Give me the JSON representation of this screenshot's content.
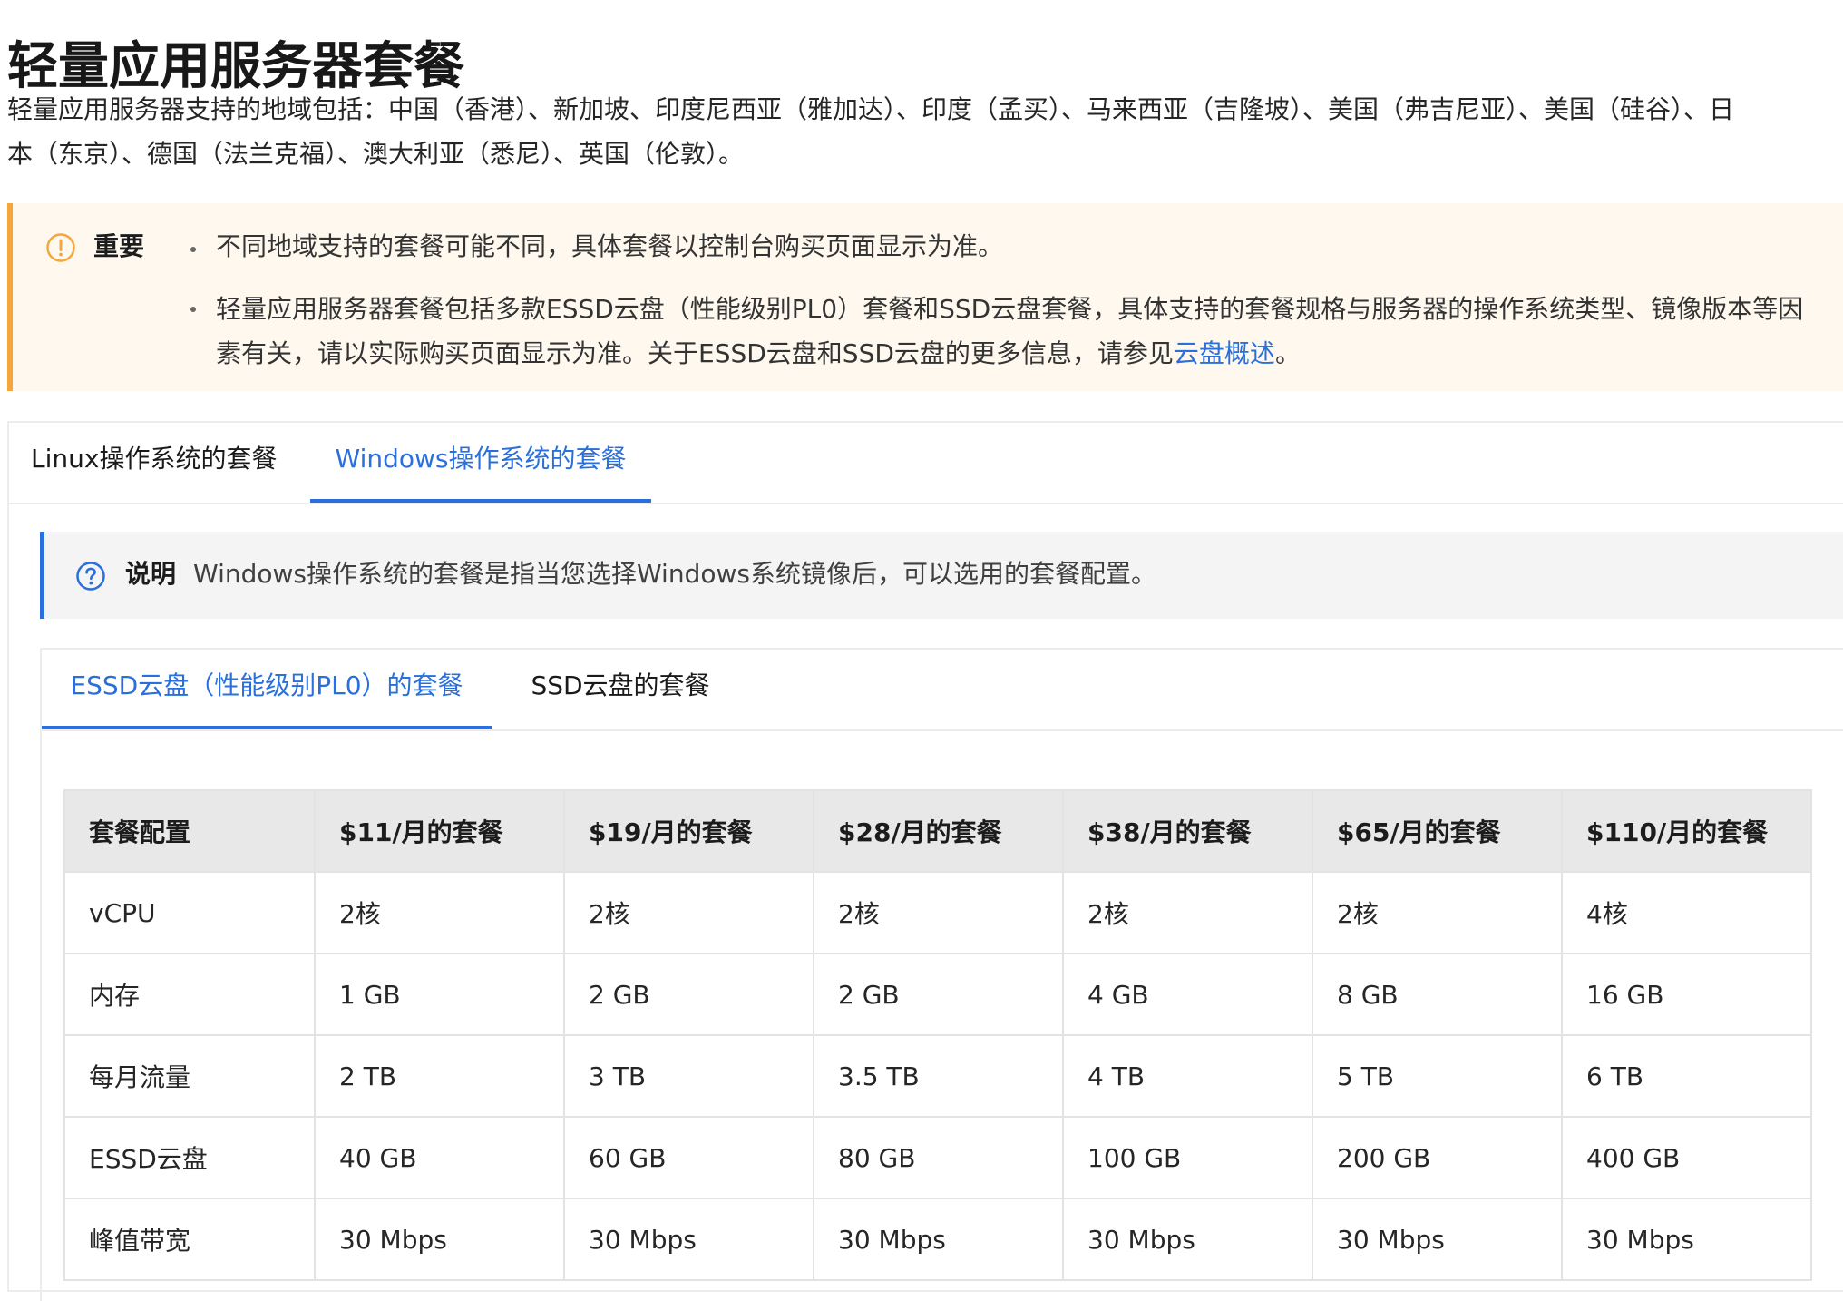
{
  "page": {
    "title": "轻量应用服务器套餐",
    "intro_line1": "轻量应用服务器支持的地域包括：中国（香港）、新加坡、印度尼西亚（雅加达）、印度（孟买）、马来西亚（吉隆坡）、美国（弗吉尼亚）、美国（硅谷）、日",
    "intro_line2": "本（东京）、德国（法兰克福）、澳大利亚（悉尼）、英国（伦敦）。"
  },
  "important": {
    "label": "重要",
    "bullet1": "不同地域支持的套餐可能不同，具体套餐以控制台购买页面显示为准。",
    "bullet2_line1": "轻量应用服务器套餐包括多款ESSD云盘（性能级别PL0）套餐和SSD云盘套餐，具体支持的套餐规格与服务器的操作系统类型、镜像版本等因",
    "bullet2_line2_prefix": "素有关，请以实际购买页面显示为准。关于ESSD云盘和SSD云盘的更多信息，请参见",
    "bullet2_link": "云盘概述",
    "bullet2_suffix": "。"
  },
  "os_tabs": {
    "linux": "Linux操作系统的套餐",
    "windows": "Windows操作系统的套餐",
    "active": "windows"
  },
  "note": {
    "label": "说明",
    "text": "Windows操作系统的套餐是指当您选择Windows系统镜像后，可以选用的套餐配置。"
  },
  "disk_tabs": {
    "essd": "ESSD云盘（性能级别PL0）的套餐",
    "ssd": "SSD云盘的套餐",
    "active": "essd"
  },
  "table": {
    "headers": [
      "套餐配置",
      "$11/月的套餐",
      "$19/月的套餐",
      "$28/月的套餐",
      "$38/月的套餐",
      "$65/月的套餐",
      "$110/月的套餐"
    ],
    "rows": [
      [
        "vCPU",
        "2核",
        "2核",
        "2核",
        "2核",
        "2核",
        "4核"
      ],
      [
        "内存",
        "1 GB",
        "2 GB",
        "2 GB",
        "4 GB",
        "8 GB",
        "16 GB"
      ],
      [
        "每月流量",
        "2 TB",
        "3 TB",
        "3.5 TB",
        "4 TB",
        "5 TB",
        "6 TB"
      ],
      [
        "ESSD云盘",
        "40 GB",
        "60 GB",
        "80 GB",
        "100 GB",
        "200 GB",
        "400 GB"
      ],
      [
        "峰值带宽",
        "30 Mbps",
        "30 Mbps",
        "30 Mbps",
        "30 Mbps",
        "30 Mbps",
        "30 Mbps"
      ]
    ]
  },
  "colors": {
    "accent": "#2a6fdb",
    "warning_border": "#f3a73c",
    "warning_bg": "#fef8ee",
    "note_bg": "#f4f4f4",
    "table_header_bg": "#e8e8e8"
  },
  "icons": {
    "important": "warning-circle-icon",
    "note": "question-circle-icon"
  }
}
